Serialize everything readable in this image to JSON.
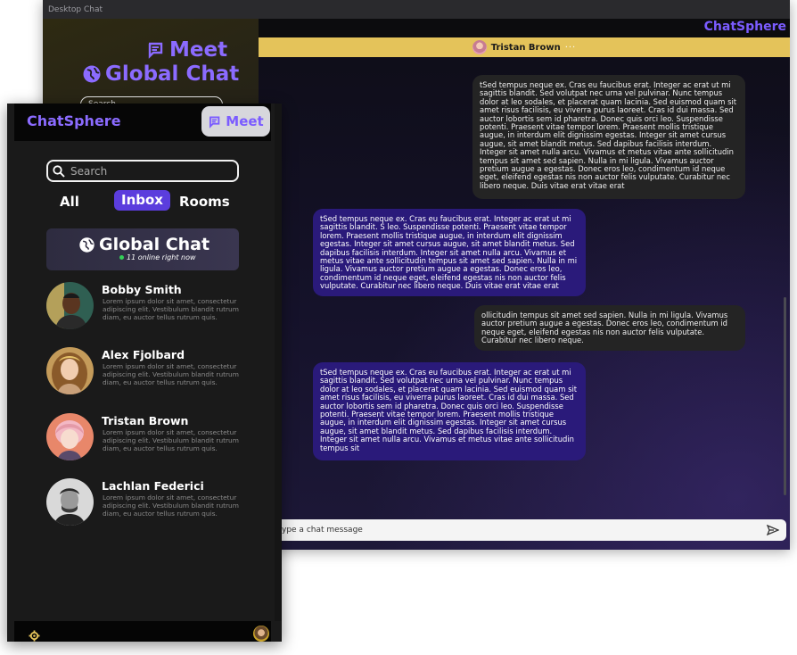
{
  "desktop": {
    "window_title": "Desktop Chat",
    "meet_label": "Meet",
    "global_chat_label": "Global Chat",
    "search_partial": "Search",
    "brand": "ChatSphere",
    "active_contact": {
      "name": "Tristan Brown",
      "menu_glyph": "···"
    },
    "messages": [
      {
        "direction": "out",
        "text": "tSed tempus neque ex. Cras eu faucibus erat. Integer ac erat ut mi sagittis blandit. Sed volutpat nec urna vel pulvinar. Nunc tempus dolor at leo sodales, et placerat quam lacinia. Sed euismod quam sit amet risus facilisis, eu viverra purus laoreet. Cras id dui massa. Sed auctor lobortis sem id pharetra. Donec quis orci leo. Suspendisse potenti. Praesent vitae tempor lorem. Praesent mollis tristique augue, in interdum elit dignissim egestas. Integer sit amet cursus augue, sit amet blandit metus. Sed dapibus facilisis interdum. Integer sit amet nulla arcu. Vivamus et metus vitae ante sollicitudin tempus sit amet sed sapien. Nulla in mi ligula. Vivamus auctor pretium augue a egestas. Donec eros leo, condimentum id neque eget, eleifend egestas nis non auctor felis vulputate. Curabitur nec libero neque. Duis vitae erat vitae erat"
      },
      {
        "direction": "in",
        "text": "tSed tempus neque ex. Cras eu faucibus erat. Integer ac erat ut mi sagittis blandit. S leo. Suspendisse potenti. Praesent vitae tempor lorem. Praesent mollis tristique augue, in interdum elit dignissim egestas. Integer sit amet cursus augue, sit amet blandit metus. Sed dapibus facilisis interdum. Integer sit amet nulla arcu. Vivamus et metus vitae ante sollicitudin tempus sit amet sed sapien. Nulla in mi ligula. Vivamus auctor pretium augue a egestas. Donec eros leo, condimentum id neque eget, eleifend egestas nis non auctor felis vulputate. Curabitur nec libero neque. Duis vitae erat vitae erat"
      },
      {
        "direction": "out",
        "text": "ollicitudin tempus sit amet sed sapien. Nulla in mi ligula. Vivamus auctor pretium augue a egestas. Donec eros leo, condimentum id neque eget, eleifend egestas nis non auctor felis vulputate. Curabitur nec libero neque."
      },
      {
        "direction": "in",
        "text": "tSed tempus neque ex. Cras eu faucibus erat. Integer ac erat ut mi sagittis blandit. Sed volutpat nec urna vel pulvinar. Nunc tempus dolor at leo sodales, et placerat quam lacinia. Sed euismod quam sit amet risus facilisis, eu viverra purus laoreet. Cras id dui massa. Sed auctor lobortis sem id pharetra. Donec quis orci leo. Suspendisse potenti. Praesent vitae tempor lorem. Praesent mollis tristique augue, in interdum elit dignissim egestas. Integer sit amet cursus augue, sit amet blandit metus. Sed dapibus facilisis interdum. Integer sit amet nulla arcu. Vivamus et metus vitae ante sollicitudin tempus sit"
      }
    ],
    "composer_placeholder": "ype a chat message"
  },
  "mobile": {
    "brand": "ChatSphere",
    "meet_label": "Meet",
    "search_placeholder": "Search",
    "tabs": [
      {
        "label": "All",
        "active": false
      },
      {
        "label": "Inbox",
        "active": true
      },
      {
        "label": "Rooms",
        "active": false
      }
    ],
    "global_chat": {
      "title": "Global Chat",
      "online_text": "11 online right now"
    },
    "contacts": [
      {
        "name": "Bobby Smith",
        "preview": "Lorem ipsum dolor sit amet, consectetur adipiscing elit. Vestibulum blandit rutrum diam, eu auctor tellus rutrum quis."
      },
      {
        "name": "Alex Fjolbard",
        "preview": "Lorem ipsum dolor sit amet, consectetur adipiscing elit. Vestibulum blandit rutrum diam, eu auctor tellus rutrum quis."
      },
      {
        "name": "Tristan Brown",
        "preview": "Lorem ipsum dolor sit amet, consectetur adipiscing elit. Vestibulum blandit rutrum diam, eu auctor tellus rutrum quis."
      },
      {
        "name": "Lachlan Federici",
        "preview": "Lorem ipsum dolor sit amet, consectetur adipiscing elit. Vestibulum blandit rutrum diam, eu auctor tellus rutrum quis."
      }
    ]
  },
  "colors": {
    "accent": "#7b5cff",
    "inbox_tab": "#5b3ddd",
    "incoming_bubble": "#2a1a7a",
    "outgoing_bubble": "#242424",
    "contact_bar": "#e4c35a",
    "online_dot": "#34d058"
  },
  "icons": {
    "meet": "meet-icon",
    "globe": "globe-icon",
    "search": "search-icon",
    "send": "send-icon",
    "settings": "gear-icon",
    "menu": "more-icon"
  }
}
